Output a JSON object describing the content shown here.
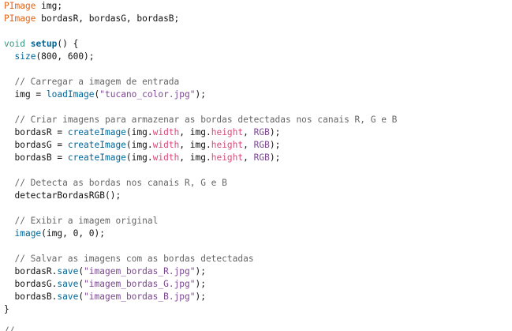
{
  "editor": {
    "lines": [
      [
        {
          "t": "PImage",
          "k": "type"
        },
        {
          "t": " img;",
          "k": "plain"
        }
      ],
      [
        {
          "t": "PImage",
          "k": "type"
        },
        {
          "t": " bordasR, bordasG, bordasB;",
          "k": "plain"
        }
      ],
      [],
      [
        {
          "t": "void",
          "k": "kw"
        },
        {
          "t": " ",
          "k": "plain"
        },
        {
          "t": "setup",
          "k": "fn-def"
        },
        {
          "t": "() {",
          "k": "plain"
        }
      ],
      [
        {
          "t": "  ",
          "k": "plain"
        },
        {
          "t": "size",
          "k": "fn"
        },
        {
          "t": "(800, 600);",
          "k": "plain"
        }
      ],
      [],
      [
        {
          "t": "  // Carregar a imagem de entrada",
          "k": "cmt"
        }
      ],
      [
        {
          "t": "  img = ",
          "k": "plain"
        },
        {
          "t": "loadImage",
          "k": "fn"
        },
        {
          "t": "(",
          "k": "plain"
        },
        {
          "t": "\"tucano_color.jpg\"",
          "k": "str"
        },
        {
          "t": ");",
          "k": "plain"
        }
      ],
      [],
      [
        {
          "t": "  // Criar imagens para armazenar as bordas detectadas nos canais R, G e B",
          "k": "cmt"
        }
      ],
      [
        {
          "t": "  bordasR = ",
          "k": "plain"
        },
        {
          "t": "createImage",
          "k": "fn"
        },
        {
          "t": "(img.",
          "k": "plain"
        },
        {
          "t": "width",
          "k": "prop"
        },
        {
          "t": ", img.",
          "k": "plain"
        },
        {
          "t": "height",
          "k": "prop"
        },
        {
          "t": ", ",
          "k": "plain"
        },
        {
          "t": "RGB",
          "k": "str"
        },
        {
          "t": ");",
          "k": "plain"
        }
      ],
      [
        {
          "t": "  bordasG = ",
          "k": "plain"
        },
        {
          "t": "createImage",
          "k": "fn"
        },
        {
          "t": "(img.",
          "k": "plain"
        },
        {
          "t": "width",
          "k": "prop"
        },
        {
          "t": ", img.",
          "k": "plain"
        },
        {
          "t": "height",
          "k": "prop"
        },
        {
          "t": ", ",
          "k": "plain"
        },
        {
          "t": "RGB",
          "k": "str"
        },
        {
          "t": ");",
          "k": "plain"
        }
      ],
      [
        {
          "t": "  bordasB = ",
          "k": "plain"
        },
        {
          "t": "createImage",
          "k": "fn"
        },
        {
          "t": "(img.",
          "k": "plain"
        },
        {
          "t": "width",
          "k": "prop"
        },
        {
          "t": ", img.",
          "k": "plain"
        },
        {
          "t": "height",
          "k": "prop"
        },
        {
          "t": ", ",
          "k": "plain"
        },
        {
          "t": "RGB",
          "k": "str"
        },
        {
          "t": ");",
          "k": "plain"
        }
      ],
      [],
      [
        {
          "t": "  // Detecta as bordas nos canais R, G e B",
          "k": "cmt"
        }
      ],
      [
        {
          "t": "  detectarBordasRGB();",
          "k": "plain"
        }
      ],
      [],
      [
        {
          "t": "  // Exibir a imagem original",
          "k": "cmt"
        }
      ],
      [
        {
          "t": "  ",
          "k": "plain"
        },
        {
          "t": "image",
          "k": "fn"
        },
        {
          "t": "(img, 0, 0);",
          "k": "plain"
        }
      ],
      [],
      [
        {
          "t": "  // Salvar as imagens com as bordas detectadas",
          "k": "cmt"
        }
      ],
      [
        {
          "t": "  bordasR.",
          "k": "plain"
        },
        {
          "t": "save",
          "k": "fn"
        },
        {
          "t": "(",
          "k": "plain"
        },
        {
          "t": "\"imagem_bordas_R.jpg\"",
          "k": "str"
        },
        {
          "t": ");",
          "k": "plain"
        }
      ],
      [
        {
          "t": "  bordasG.",
          "k": "plain"
        },
        {
          "t": "save",
          "k": "fn"
        },
        {
          "t": "(",
          "k": "plain"
        },
        {
          "t": "\"imagem_bordas_G.jpg\"",
          "k": "str"
        },
        {
          "t": ");",
          "k": "plain"
        }
      ],
      [
        {
          "t": "  bordasB.",
          "k": "plain"
        },
        {
          "t": "save",
          "k": "fn"
        },
        {
          "t": "(",
          "k": "plain"
        },
        {
          "t": "\"imagem_bordas_B.jpg\"",
          "k": "str"
        },
        {
          "t": ");",
          "k": "plain"
        }
      ],
      [
        {
          "t": "}",
          "k": "plain"
        }
      ]
    ],
    "partial_line": "// ..."
  },
  "colors": {
    "type": "#e2661a",
    "keyword": "#33997e",
    "function": "#006699",
    "string": "#7d4793",
    "comment": "#666666",
    "property": "#d94a7a",
    "background": "#ffffff"
  }
}
